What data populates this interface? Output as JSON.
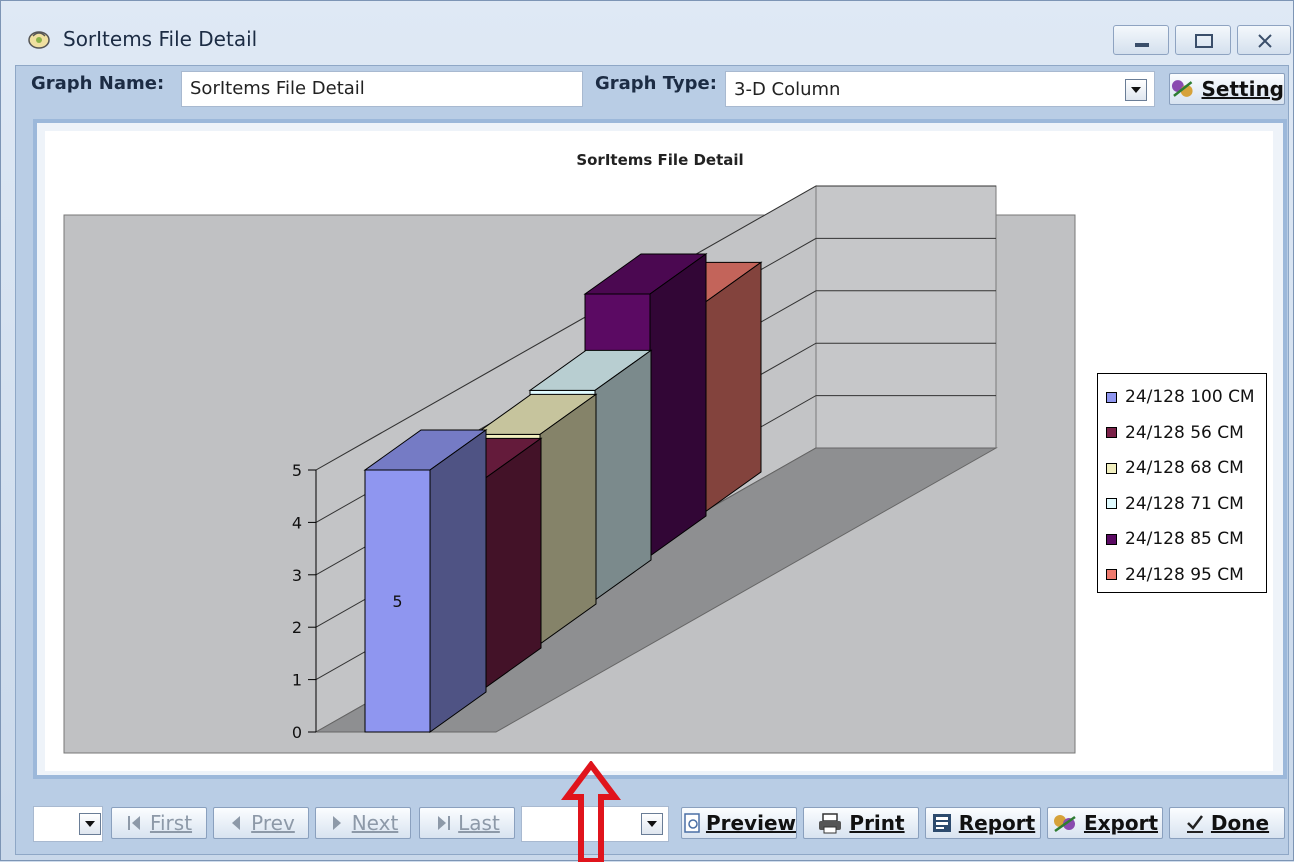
{
  "window": {
    "title": "SorItems File Detail",
    "icon": "app-icon"
  },
  "toolbar": {
    "graph_name_label": "Graph Name:",
    "graph_name_value": "SorItems File Detail",
    "graph_type_label": "Graph Type:",
    "graph_type_value": "3-D Column",
    "setting_label": "Setting"
  },
  "chart_data": {
    "type": "bar",
    "title": "SorItems File Detail",
    "ylim": [
      0,
      5
    ],
    "y_ticks": [
      "0",
      "1",
      "2",
      "3",
      "4",
      "5"
    ],
    "series": [
      {
        "name": "24/128 100 CM",
        "value": 5,
        "color": "#8f96f0"
      },
      {
        "name": "24/128 56 CM",
        "value": 4,
        "color": "#7a2148"
      },
      {
        "name": "24/128 68 CM",
        "value": 4,
        "color": "#f1efbf"
      },
      {
        "name": "24/128 71 CM",
        "value": 4,
        "color": "#e0fbff"
      },
      {
        "name": "24/128 85 CM",
        "value": 5,
        "color": "#5b0a63"
      },
      {
        "name": "24/128 95 CM",
        "value": 4,
        "color": "#ee7a6e"
      }
    ],
    "data_labels": [
      "5"
    ],
    "legend_position": "right",
    "grid": true
  },
  "navigation": {
    "first": "First",
    "prev": "Prev",
    "next": "Next",
    "last": "Last"
  },
  "actions": {
    "preview": "Preview",
    "print": "Print",
    "report": "Report",
    "export": "Export",
    "done": "Done"
  }
}
